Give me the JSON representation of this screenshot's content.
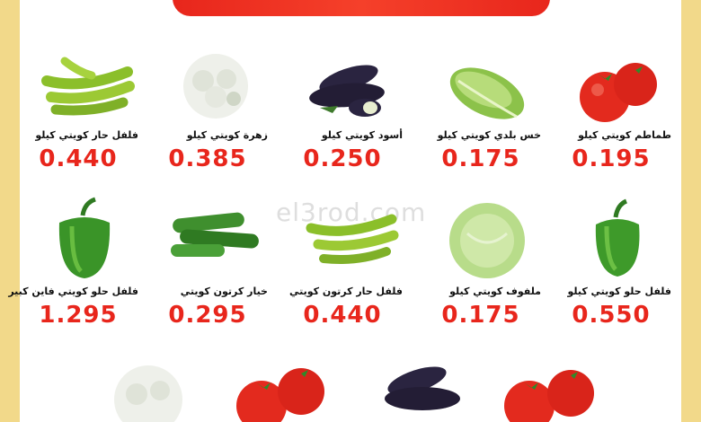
{
  "banner": {
    "title": ""
  },
  "watermark": "el3rod.com",
  "row1": [
    {
      "name": "طماطم كويتي كيلو",
      "price": "0.195",
      "icon": "tomato-icon"
    },
    {
      "name": "خس بلدي كويتي كيلو",
      "price": "0.175",
      "icon": "lettuce-icon"
    },
    {
      "name": "أسود كويتي كيلو",
      "price": "0.250",
      "icon": "eggplant-icon"
    },
    {
      "name": "زهرة كويتي كيلو",
      "price": "0.385",
      "icon": "cauliflower-icon"
    },
    {
      "name": "فلفل حار كويتي كيلو",
      "price": "0.440",
      "icon": "chili-pepper-icon"
    }
  ],
  "row2": [
    {
      "name": "فلفل حلو كويتي كيلو",
      "price": "0.550",
      "icon": "green-bell-pepper-icon"
    },
    {
      "name": "ملفوف كويتي كيلو",
      "price": "0.175",
      "icon": "cabbage-icon"
    },
    {
      "name": "فلفل حار كرتون كويتي",
      "price": "0.440",
      "icon": "chili-pepper-icon"
    },
    {
      "name": "خيار كرتون كويتي",
      "price": "0.295",
      "icon": "cucumber-icon"
    },
    {
      "name": "فلفل حلو كويتي فاين كبير",
      "price": "1.295",
      "icon": "green-bell-pepper-icon"
    }
  ],
  "colors": {
    "price": "#e8261c",
    "highlight": "#fde38a",
    "banner": "#e8261c",
    "background": "#f2d98a"
  }
}
